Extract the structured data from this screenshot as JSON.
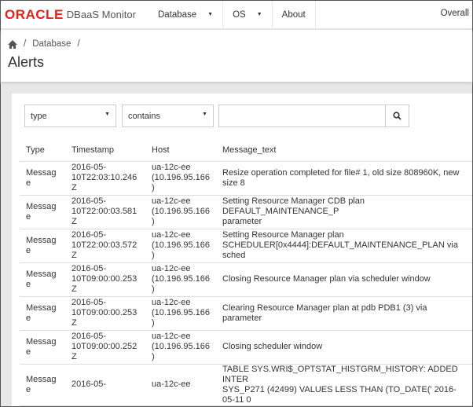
{
  "nav": {
    "logo": "ORACLE",
    "brand": "DBaaS Monitor",
    "items": [
      "Database",
      "OS",
      "About"
    ],
    "overall": "Overall"
  },
  "breadcrumb": {
    "database": "Database",
    "sep": "/"
  },
  "page_title": "Alerts",
  "filters": {
    "field": "type",
    "operator": "contains",
    "value": ""
  },
  "table": {
    "headers": [
      "Type",
      "Timestamp",
      "Host",
      "Message_text"
    ],
    "rows": [
      [
        "Message",
        "2016-05-",
        "10T22:03:10.246Z",
        "ua-12c-ee",
        "(10.196.95.166)",
        "Resize operation completed for file# 1, old size 808960K, new size 8",
        ""
      ],
      [
        "Message",
        "2016-05-",
        "10T22:00:03.581Z",
        "ua-12c-ee",
        "(10.196.95.166)",
        "Setting Resource Manager CDB plan DEFAULT_MAINTENANCE_P",
        "parameter"
      ],
      [
        "Message",
        "2016-05-",
        "10T22:00:03.572Z",
        "ua-12c-ee",
        "(10.196.95.166)",
        "Setting Resource Manager plan",
        "SCHEDULER[0x4444]:DEFAULT_MAINTENANCE_PLAN via sched"
      ],
      [
        "Message",
        "2016-05-",
        "10T09:00:00.253Z",
        "ua-12c-ee",
        "(10.196.95.166)",
        "Closing Resource Manager plan via scheduler window",
        ""
      ],
      [
        "Message",
        "2016-05-",
        "10T09:00:00.253Z",
        "ua-12c-ee",
        "(10.196.95.166)",
        "Clearing Resource Manager plan at pdb PDB1 (3) via parameter",
        ""
      ],
      [
        "Message",
        "2016-05-",
        "10T09:00:00.252Z",
        "ua-12c-ee",
        "(10.196.95.166)",
        "Closing scheduler window",
        ""
      ],
      [
        "Message",
        "2016-05-",
        "",
        "ua-12c-ee",
        "",
        "TABLE SYS.WRI$_OPTSTAT_HISTGRM_HISTORY: ADDED INTER",
        "SYS_P271 (42499) VALUES LESS THAN (TO_DATE(' 2016-05-11 0"
      ]
    ]
  }
}
